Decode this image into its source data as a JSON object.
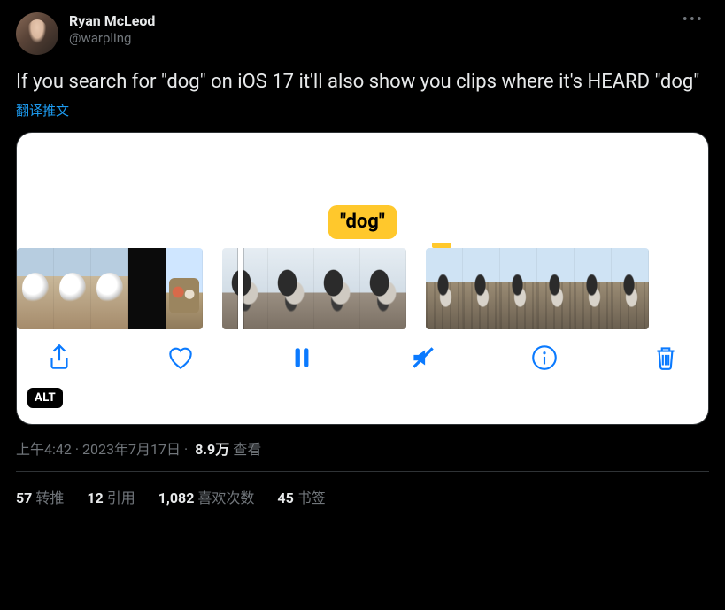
{
  "author": {
    "display_name": "Ryan McLeod",
    "handle": "@warpling"
  },
  "tweet_text": "If you search for \"dog\" on iOS 17 it'll also show you clips where it's HEARD \"dog\"",
  "translate_label": "翻译推文",
  "media": {
    "caption_tag": "\"dog\"",
    "alt_badge": "ALT"
  },
  "meta": {
    "time": "上午4:42",
    "dot": " · ",
    "date": "2023年7月17日",
    "views_number": "8.9万",
    "views_label": " 查看"
  },
  "stats": {
    "retweets_num": "57",
    "retweets_label": "转推",
    "quotes_num": "12",
    "quotes_label": "引用",
    "likes_num": "1,082",
    "likes_label": "喜欢次数",
    "bookmarks_num": "45",
    "bookmarks_label": "书签"
  }
}
